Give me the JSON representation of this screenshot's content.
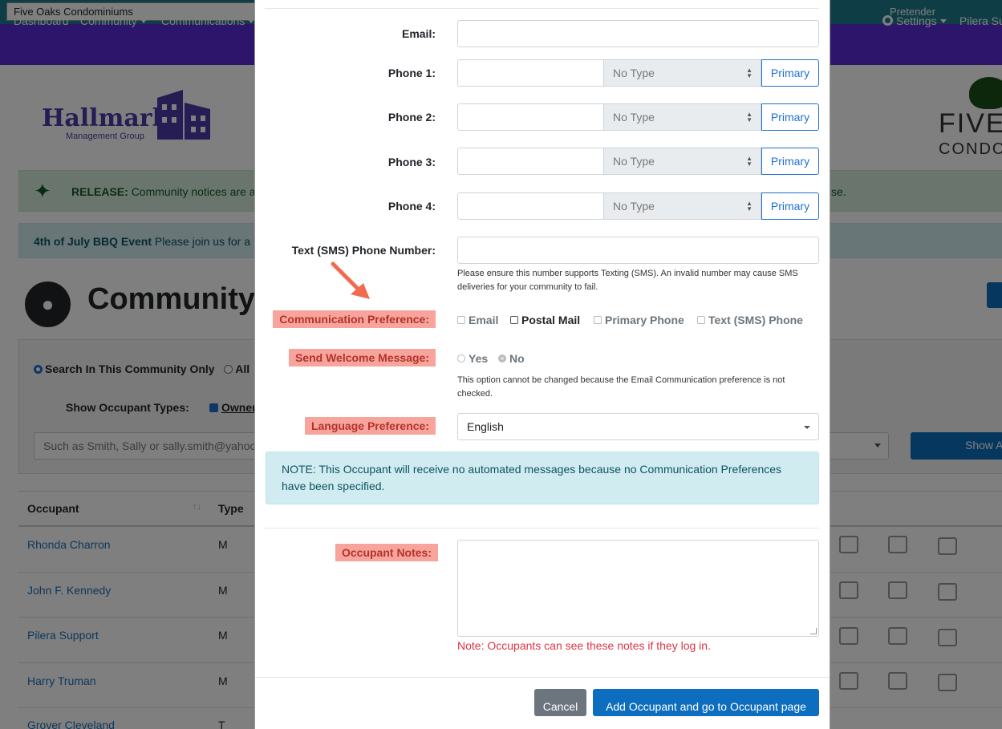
{
  "topbar": {
    "community_name": "Five Oaks Condominiums",
    "pretender_label": "Pretender"
  },
  "nav": {
    "items": [
      "Dashboard",
      "Community",
      "Communications"
    ],
    "settings_label": "Settings",
    "user_label": "Pilera Su"
  },
  "branding": {
    "mgmt_logo_title": "Hallmark",
    "mgmt_logo_sub": "Management Group",
    "community_logo_line1": "FIVE",
    "community_logo_line2": "CONDO"
  },
  "alerts": {
    "release_label": "RELEASE:",
    "release_text": "Community notices are a",
    "release_end": "se.",
    "event_title": "4th of July BBQ Event",
    "event_text": "Please join us for a"
  },
  "page": {
    "title": "Community O"
  },
  "search": {
    "scope_this": "Search In This Community Only",
    "scope_all": "All",
    "types_label": "Show Occupant Types:",
    "owner_label": "Owner",
    "placeholder": "Such as Smith, Sally or sally.smith@yahoo",
    "show_button": "Show A"
  },
  "table": {
    "headers": {
      "occupant": "Occupant",
      "type": "Type"
    },
    "rows": [
      {
        "name": "Rhonda Charron",
        "type": "M"
      },
      {
        "name": "John F. Kennedy",
        "type": "M"
      },
      {
        "name": "Pilera Support",
        "type": "M"
      },
      {
        "name": "Harry Truman",
        "type": "M"
      },
      {
        "name": "Grover Cleveland",
        "type": "T"
      }
    ]
  },
  "modal": {
    "email_label": "Email:",
    "phones": [
      {
        "label": "Phone 1:",
        "type": "No Type",
        "primary": "Primary"
      },
      {
        "label": "Phone 2:",
        "type": "No Type",
        "primary": "Primary"
      },
      {
        "label": "Phone 3:",
        "type": "No Type",
        "primary": "Primary"
      },
      {
        "label": "Phone 4:",
        "type": "No Type",
        "primary": "Primary"
      }
    ],
    "sms_label": "Text (SMS) Phone Number:",
    "sms_help": "Please ensure this number supports Texting (SMS). An invalid number may cause SMS deliveries for your community to fail.",
    "comm_pref_label": "Communication Preference:",
    "comm_options": {
      "email": "Email",
      "postal": "Postal Mail",
      "primary_phone": "Primary Phone",
      "sms_phone": "Text (SMS) Phone"
    },
    "welcome_label": "Send Welcome Message:",
    "welcome_yes": "Yes",
    "welcome_no": "No",
    "welcome_help": "This option cannot be changed because the Email Communication preference is not checked.",
    "language_label": "Language Preference:",
    "language_value": "English",
    "note_text": "NOTE: This Occupant will receive no automated messages because no Communication Preferences have been specified.",
    "notes_label": "Occupant Notes:",
    "notes_warning": "Note: Occupants can see these notes if they log in.",
    "cancel_button": "Cancel",
    "add_button": "Add Occupant and go to Occupant page"
  },
  "colors": {
    "nav": "#5b2bd6",
    "primary": "#0d6ebf",
    "highlight": "#f7a59c",
    "highlight_text": "#b3322b",
    "arrow": "#f26b4f"
  }
}
